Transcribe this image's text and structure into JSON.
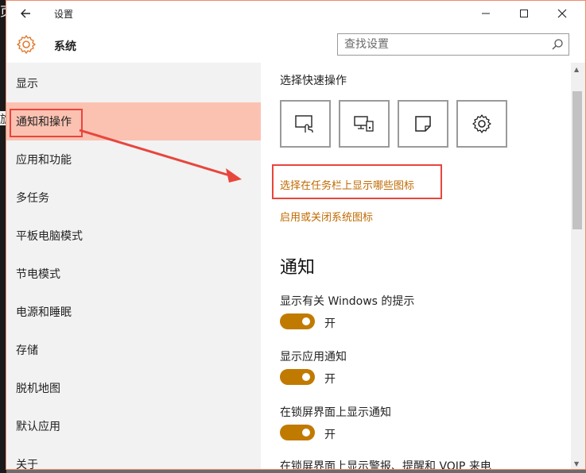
{
  "window": {
    "title": "设置",
    "minimize_icon": "minimize-icon",
    "maximize_icon": "maximize-icon",
    "close_icon": "close-icon"
  },
  "header": {
    "title": "系统",
    "search_placeholder": "查找设置"
  },
  "sidebar": {
    "items": [
      {
        "label": "显示",
        "active": false
      },
      {
        "label": "通知和操作",
        "active": true
      },
      {
        "label": "应用和功能",
        "active": false
      },
      {
        "label": "多任务",
        "active": false
      },
      {
        "label": "平板电脑模式",
        "active": false
      },
      {
        "label": "节电模式",
        "active": false
      },
      {
        "label": "电源和睡眠",
        "active": false
      },
      {
        "label": "存储",
        "active": false
      },
      {
        "label": "脱机地图",
        "active": false
      },
      {
        "label": "默认应用",
        "active": false
      },
      {
        "label": "关于",
        "active": false
      }
    ]
  },
  "content": {
    "quick_actions_title": "选择快速操作",
    "quick_action_icons": [
      "tablet-mode-icon",
      "project-icon",
      "note-icon",
      "settings-icon"
    ],
    "link_taskbar_icons": "选择在任务栏上显示哪些图标",
    "link_system_icons": "启用或关闭系统图标",
    "notifications_title": "通知",
    "settings": [
      {
        "label": "显示有关 Windows 的提示",
        "toggle": "开"
      },
      {
        "label": "显示应用通知",
        "toggle": "开"
      },
      {
        "label": "在锁屏界面上显示通知",
        "toggle": "开"
      },
      {
        "label": "在锁屏界面上显示警报、提醒和 VOIP 来电"
      }
    ]
  },
  "colors": {
    "accent": "#c17a00",
    "link": "#c06a00",
    "active_bg": "#fbc2b2",
    "annotation": "#e8453c"
  },
  "edge": {
    "char_top": "页",
    "char_mid": "旋"
  }
}
